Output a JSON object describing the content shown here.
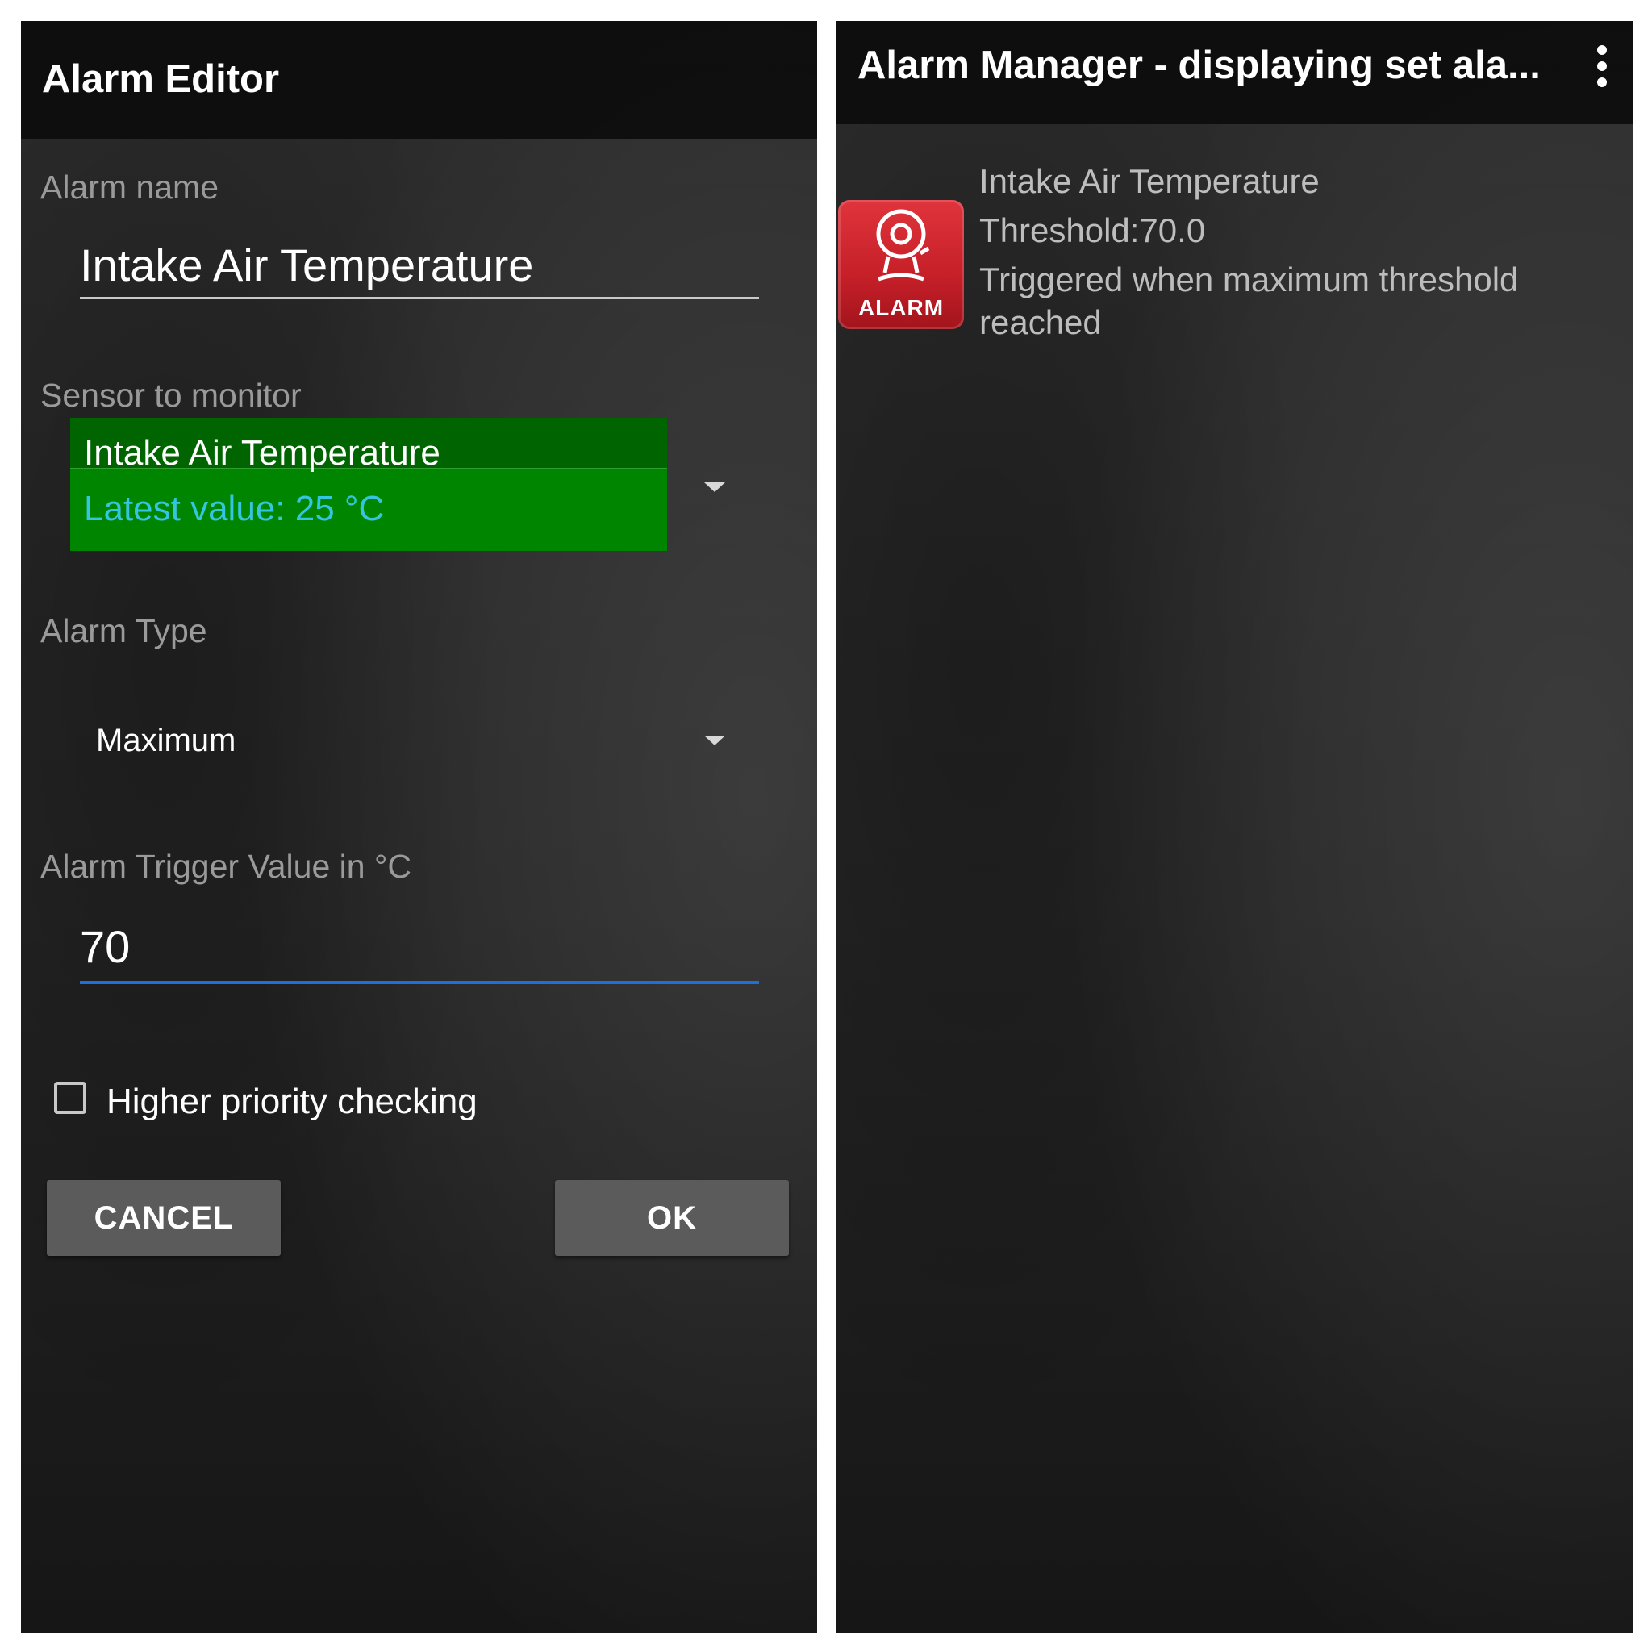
{
  "editor": {
    "title": "Alarm Editor",
    "alarm_name_label": "Alarm name",
    "alarm_name_value": "Intake Air Temperature",
    "sensor_label": "Sensor to monitor",
    "sensor_name": "Intake Air Temperature",
    "sensor_latest_value": "Latest value: 25 °C",
    "alarm_type_label": "Alarm Type",
    "alarm_type_value": "Maximum",
    "trigger_label": "Alarm Trigger Value in °C",
    "trigger_value": "70",
    "priority_checkbox_label": "Higher priority checking",
    "priority_checked": false,
    "cancel_label": "CANCEL",
    "ok_label": "OK"
  },
  "manager": {
    "title": "Alarm Manager - displaying set ala...",
    "menu_icon": "overflow-menu-icon",
    "alarm_item": {
      "icon": "alarm-icon",
      "icon_text": "ALARM",
      "name": "Intake Air Temperature",
      "threshold": "Threshold:70.0",
      "description_line1": "Triggered when maximum threshold",
      "description_line2": "reached"
    }
  },
  "colors": {
    "sensor_box": "#008500",
    "sensor_header": "#006400",
    "sensor_value_text": "#34c6e0",
    "focused_underline": "#1e6fd9",
    "button": "#5b5b5b",
    "alarm_icon_red": "#c51f28"
  }
}
